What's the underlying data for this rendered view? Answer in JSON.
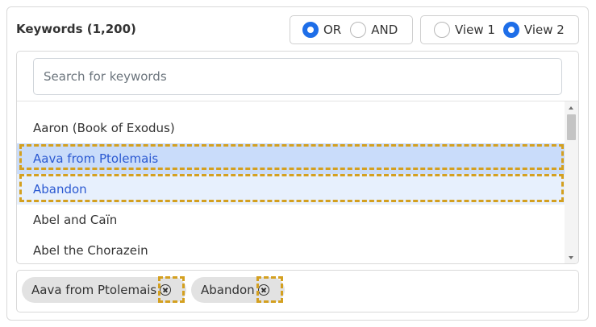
{
  "header": {
    "title": "Keywords (1,200)"
  },
  "logic_toggle": {
    "options": [
      {
        "label": "OR",
        "selected": true
      },
      {
        "label": "AND",
        "selected": false
      }
    ]
  },
  "view_toggle": {
    "options": [
      {
        "label": "View 1",
        "selected": false
      },
      {
        "label": "View 2",
        "selected": true
      }
    ]
  },
  "search": {
    "placeholder": "Search for keywords",
    "value": ""
  },
  "list": {
    "items": [
      {
        "label": "Aaron (Book of Exodus)",
        "state": "normal"
      },
      {
        "label": "Aava from Ptolemais",
        "state": "selected"
      },
      {
        "label": "Abandon",
        "state": "selected-light"
      },
      {
        "label": "Abel and Caïn",
        "state": "normal"
      },
      {
        "label": "Abel the Chorazein",
        "state": "normal"
      }
    ]
  },
  "selected_tags": [
    {
      "label": "Aava from Ptolemais"
    },
    {
      "label": "Abandon"
    }
  ],
  "colors": {
    "accent": "#1e6ee8",
    "selected_bg": "#c9dcfa",
    "selected_text": "#2b59d1",
    "highlight": "#d4a020"
  }
}
